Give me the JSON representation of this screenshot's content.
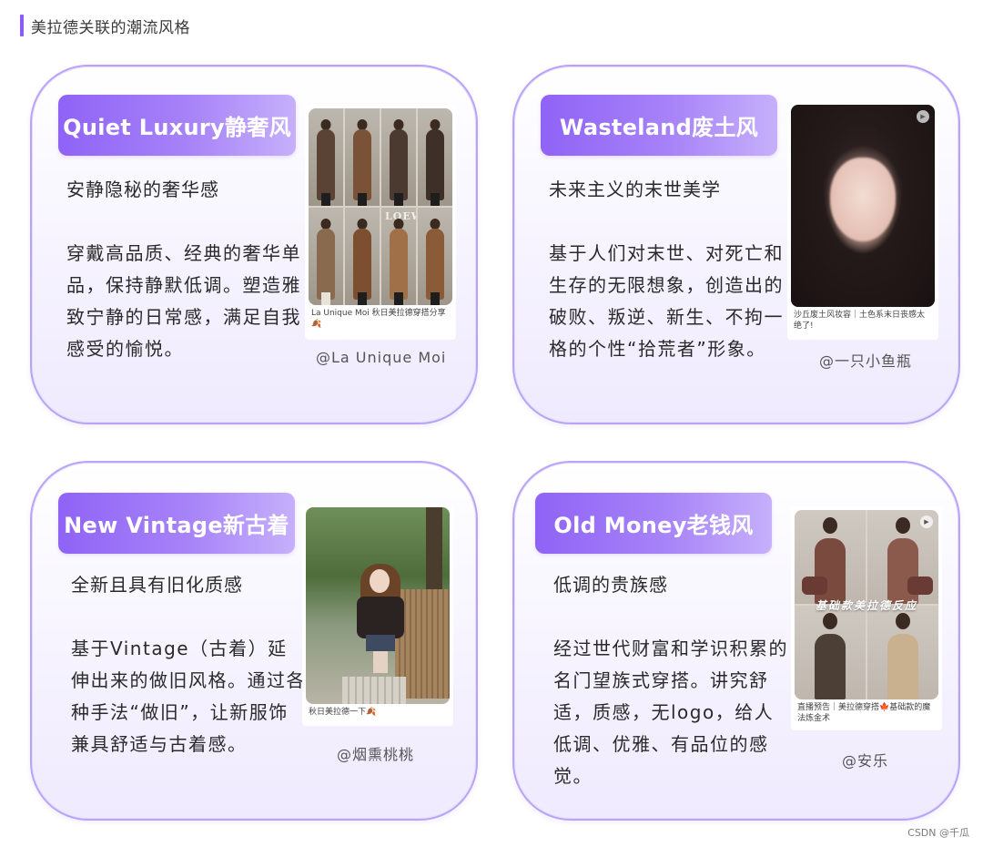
{
  "header": {
    "title": "美拉德关联的潮流风格"
  },
  "cards": [
    {
      "title": "Quiet Luxury静奢风",
      "subtitle": "安静隐秘的奢华感",
      "body": "穿戴高品质、经典的奢华单品，保持静默低调。塑造雅致宁静的日常感，满足自我感受的愉悦。",
      "photo": {
        "caption": "La Unique Moi 秋日美拉德穿搭分享🍂",
        "overlay_text": "LOEWE"
      },
      "credit": "@La Unique Moi"
    },
    {
      "title": "Wasteland废土风",
      "subtitle": "未来主义的末世美学",
      "body": "基于人们对末世、对死亡和生存的无限想象，创造出的破败、叛逆、新生、不拘一格的个性“拾荒者”形象。",
      "photo": {
        "caption": "沙丘废土风妆容｜土色系末日丧感太绝了!",
        "overlay_text": ""
      },
      "credit": "@一只小鱼瓶"
    },
    {
      "title": "New Vintage新古着",
      "subtitle": "全新且具有旧化质感",
      "body": "基于Vintage（古着）延伸出来的做旧风格。通过各种手法“做旧”，让新服饰兼具舒适与古着感。",
      "photo": {
        "caption": "秋日美拉德一下🍂",
        "overlay_text": ""
      },
      "credit": "@烟熏桃桃"
    },
    {
      "title": "Old Money老钱风",
      "subtitle": "低调的贵族感",
      "body": "经过世代财富和学识积累的名门望族式穿搭。讲究舒适，质感，无logo，给人低调、优雅、有品位的感觉。",
      "photo": {
        "caption": "直播预告｜美拉德穿搭🍁基础款的魔法炼金术",
        "overlay_text": "基础款美拉德反应"
      },
      "credit": "@安乐"
    }
  ],
  "footer": {
    "watermark": "CSDN @千瓜"
  },
  "colors": {
    "accent": "#8a5cf5",
    "pill_start": "#8f63f6",
    "pill_end": "#c6b0fb",
    "card_border": "#b9a3f7"
  },
  "icons": {
    "video": "play-icon"
  }
}
